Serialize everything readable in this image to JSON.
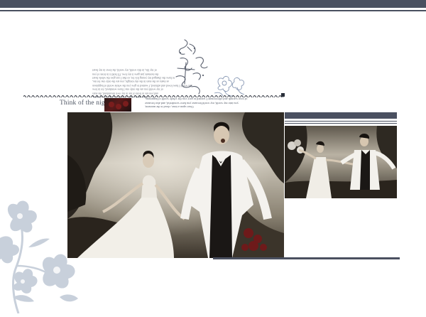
{
  "header": {
    "color": "#4a5060"
  },
  "poem": {
    "lines": [
      "Once upon a time, I could see you in my dreams,",
      "and you are in front of me in my own dreamland, the stars",
      "of my world you are the only one I have wondered, for in love",
      "the world I have loved and admired, I wanted to give you the whole world of happiness",
      "as many as the stars in the sky tonight, you are the only one for me,",
      "to have the changed my young life for, so that I can give the whole heart",
      "the moment just gave it my love. I'll hold it in front of you",
      "of my life, in this world, my world, the lover in my heart"
    ]
  },
  "subtitle": "Think of the night",
  "caption": {
    "lines": [
      "Once upon a time, cloud is the moment,",
      "you into my world, my world because you have wonderful, and also because",
      "of your warmth and affectionate I wanted to give you the whole world of happiness."
    ]
  },
  "decor": {
    "calligraphy": "calligraphy-ornament",
    "flower_small": "flower-ornament-small",
    "flower_large": "flower-ornament-large",
    "flower_color": "#c3cbd8"
  },
  "photos": {
    "main": "wedding-couple-running-photo",
    "side": "wedding-couple-balloons-photo"
  }
}
